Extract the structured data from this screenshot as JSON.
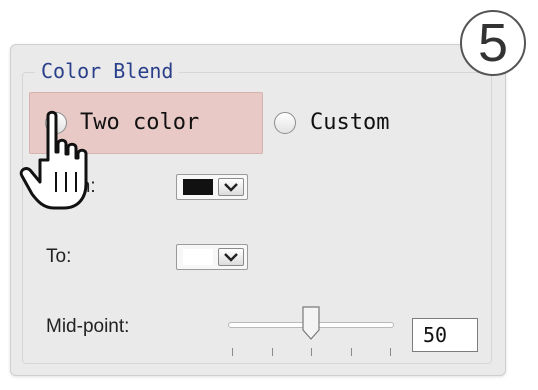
{
  "step_badge": "5",
  "group": {
    "title": "Color Blend",
    "blend_options": [
      {
        "label": "Two color",
        "selected": false
      },
      {
        "label": "Custom",
        "selected": false
      }
    ]
  },
  "from": {
    "label": "From:",
    "color": "#111111"
  },
  "to": {
    "label": "To:",
    "color": "#ffffff"
  },
  "midpoint": {
    "label": "Mid-point:",
    "value": "50",
    "fraction": 0.5
  },
  "icons": {
    "cursor": "hand-pointer-icon",
    "dropdown": "chevron-down-icon"
  },
  "colors": {
    "highlight": "#e8c9c6",
    "title": "#2a3f8a",
    "panel": "#eaeaea"
  }
}
